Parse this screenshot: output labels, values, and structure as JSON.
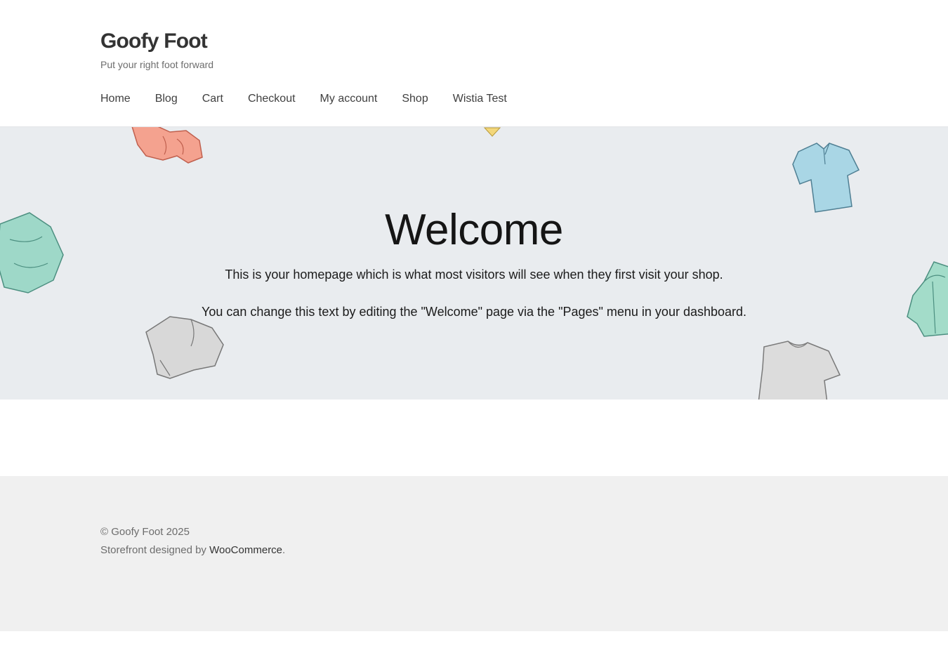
{
  "header": {
    "site_title": "Goofy Foot",
    "tagline": "Put your right foot forward"
  },
  "nav": {
    "items": [
      {
        "label": "Home"
      },
      {
        "label": "Blog"
      },
      {
        "label": "Cart"
      },
      {
        "label": "Checkout"
      },
      {
        "label": "My account"
      },
      {
        "label": "Shop"
      },
      {
        "label": "Wistia Test"
      }
    ]
  },
  "hero": {
    "title": "Welcome",
    "paragraph_1": "This is your homepage which is what most visitors will see when they first visit your shop.",
    "paragraph_2": "You can change this text by editing the \"Welcome\" page via the \"Pages\" menu in your dashboard.",
    "background_color": "#e9ecef"
  },
  "footer": {
    "copyright": "© Goofy Foot 2025",
    "credit_prefix": "Storefront designed by ",
    "credit_link": "WooCommerce",
    "credit_suffix": ".",
    "background_color": "#f0f0f0"
  }
}
